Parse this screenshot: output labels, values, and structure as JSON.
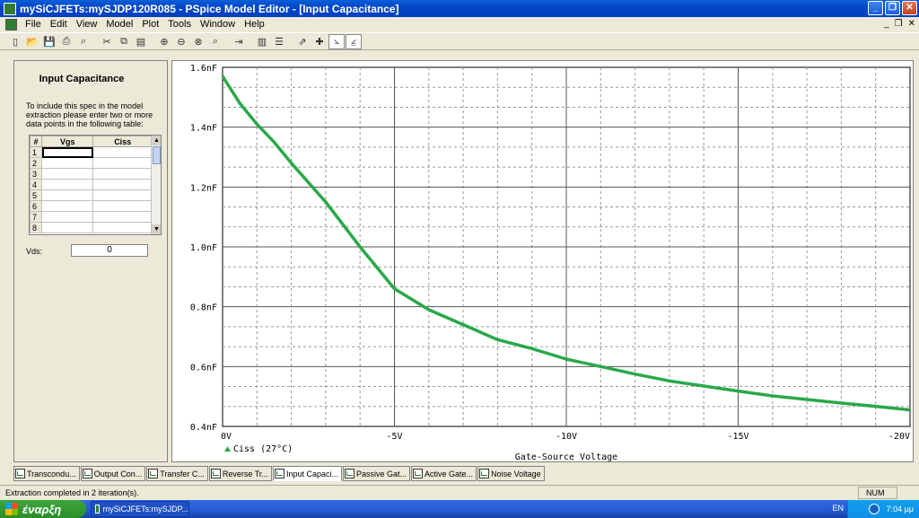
{
  "window": {
    "title": "mySiCJFETs:mySJDP120R085 - PSpice Model Editor - [Input Capacitance]"
  },
  "menu": [
    "File",
    "Edit",
    "View",
    "Model",
    "Plot",
    "Tools",
    "Window",
    "Help"
  ],
  "toolbar_icons": [
    "new-icon",
    "open-icon",
    "save-icon",
    "print-icon",
    "print-preview-icon",
    "cut-icon",
    "copy-icon",
    "paste-icon",
    "zoom-in-icon",
    "zoom-out-icon",
    "zoom-area-icon",
    "zoom-fit-icon",
    "extract-icon",
    "table-icon",
    "table-rows-icon",
    "plot-axis-icon",
    "cursor-icon",
    "plot-x-icon",
    "plot-y-icon"
  ],
  "spec_panel": {
    "title": "Input Capacitance",
    "description": "To include this spec in the model extraction please enter two or more data points in the following table:",
    "table": {
      "headers": [
        "#",
        "Vgs",
        "Ciss"
      ],
      "rows": [
        "1",
        "2",
        "3",
        "4",
        "5",
        "6",
        "7",
        "8"
      ]
    },
    "vds_label": "Vds:",
    "vds_value": "0"
  },
  "chart_data": {
    "type": "line",
    "title": "",
    "xlabel": "Gate-Source Voltage",
    "ylabel": "",
    "x_ticks": [
      "0V",
      "-5V",
      "-10V",
      "-15V",
      "-20V"
    ],
    "y_ticks": [
      "0.4nF",
      "0.6nF",
      "0.8nF",
      "1.0nF",
      "1.2nF",
      "1.4nF",
      "1.6nF"
    ],
    "xlim": [
      0,
      -20
    ],
    "ylim": [
      0.4,
      1.6
    ],
    "grid": true,
    "series": [
      {
        "name": "Ciss (27°C)",
        "color": "#2aa84a",
        "x": [
          0,
          -0.5,
          -1,
          -1.5,
          -2,
          -3,
          -4,
          -5,
          -6,
          -7,
          -8,
          -9,
          -10,
          -11,
          -12,
          -13,
          -14,
          -15,
          -16,
          -17,
          -18,
          -19,
          -20
        ],
        "y": [
          1.57,
          1.48,
          1.41,
          1.35,
          1.28,
          1.15,
          1.0,
          0.86,
          0.79,
          0.74,
          0.69,
          0.66,
          0.625,
          0.6,
          0.575,
          0.552,
          0.535,
          0.518,
          0.502,
          0.49,
          0.478,
          0.467,
          0.455
        ]
      }
    ]
  },
  "tabs": [
    {
      "label": "Transcondu...",
      "active": false
    },
    {
      "label": "Output Con...",
      "active": false
    },
    {
      "label": "Transfer C...",
      "active": false
    },
    {
      "label": "Reverse Tr...",
      "active": false
    },
    {
      "label": "Input Capaci...",
      "active": true
    },
    {
      "label": "Passive Gat...",
      "active": false
    },
    {
      "label": "Active Gate...",
      "active": false
    },
    {
      "label": "Noise Voltage",
      "active": false
    }
  ],
  "status": {
    "message": "Extraction completed in 2 iteration(s).",
    "num": "NUM"
  },
  "taskbar": {
    "start_label": "έναρξη",
    "task_label": "mySiCJFETs:mySJDP...",
    "lang": "EN",
    "clock": "7:04 μμ"
  }
}
